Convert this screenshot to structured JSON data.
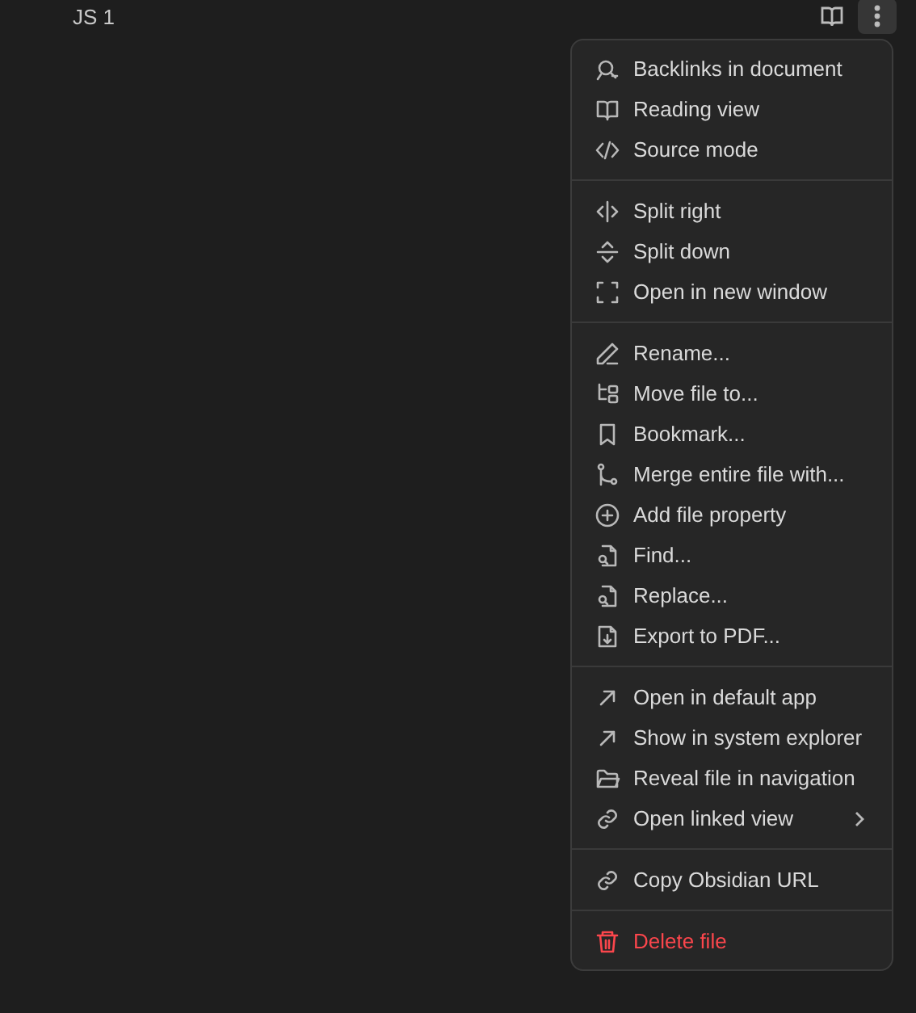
{
  "header": {
    "title": "JS 1"
  },
  "menu": {
    "groups": [
      {
        "items": [
          {
            "label": "Backlinks in document",
            "kind": "normal",
            "submenu": false
          },
          {
            "label": "Reading view",
            "kind": "normal",
            "submenu": false
          },
          {
            "label": "Source mode",
            "kind": "normal",
            "submenu": false
          }
        ]
      },
      {
        "items": [
          {
            "label": "Split right",
            "kind": "normal",
            "submenu": false
          },
          {
            "label": "Split down",
            "kind": "normal",
            "submenu": false
          },
          {
            "label": "Open in new window",
            "kind": "normal",
            "submenu": false
          }
        ]
      },
      {
        "items": [
          {
            "label": "Rename...",
            "kind": "normal",
            "submenu": false
          },
          {
            "label": "Move file to...",
            "kind": "normal",
            "submenu": false
          },
          {
            "label": "Bookmark...",
            "kind": "normal",
            "submenu": false
          },
          {
            "label": "Merge entire file with...",
            "kind": "normal",
            "submenu": false
          },
          {
            "label": "Add file property",
            "kind": "normal",
            "submenu": false
          },
          {
            "label": "Find...",
            "kind": "normal",
            "submenu": false
          },
          {
            "label": "Replace...",
            "kind": "normal",
            "submenu": false
          },
          {
            "label": "Export to PDF...",
            "kind": "normal",
            "submenu": false
          }
        ]
      },
      {
        "items": [
          {
            "label": "Open in default app",
            "kind": "normal",
            "submenu": false
          },
          {
            "label": "Show in system explorer",
            "kind": "normal",
            "submenu": false
          },
          {
            "label": "Reveal file in navigation",
            "kind": "normal",
            "submenu": false
          },
          {
            "label": "Open linked view",
            "kind": "normal",
            "submenu": true
          }
        ]
      },
      {
        "items": [
          {
            "label": "Copy Obsidian URL",
            "kind": "normal",
            "submenu": false
          }
        ]
      },
      {
        "items": [
          {
            "label": "Delete file",
            "kind": "danger",
            "submenu": false
          }
        ]
      }
    ]
  }
}
